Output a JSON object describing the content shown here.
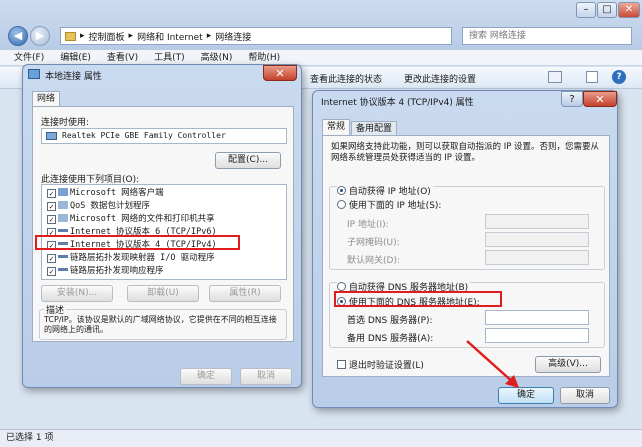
{
  "window": {
    "min": "–",
    "max": "□",
    "close": "✕"
  },
  "address": {
    "path_1": "控制面板",
    "path_2": "网络和 Internet",
    "path_3": "网络连接",
    "sep": "▸"
  },
  "search": {
    "placeholder": "搜索 网络连接"
  },
  "menu": [
    "文件(F)",
    "编辑(E)",
    "查看(V)",
    "工具(T)",
    "高级(N)",
    "帮助(H)"
  ],
  "cmdbar": {
    "view_status": "查看此连接的状态",
    "change_settings": "更改此连接的设置"
  },
  "status": {
    "selected": "已选择 1 项"
  },
  "local_dialog": {
    "title": "本地连接 属性",
    "tab_network": "网络",
    "connect_using_label": "连接时使用:",
    "adapter": "Realtek PCIe GBE Family Controller",
    "configure_button": "配置(C)...",
    "items_label": "此连接使用下列项目(O):",
    "items": [
      "Microsoft 网络客户端",
      "QoS 数据包计划程序",
      "Microsoft 网络的文件和打印机共享",
      "Internet 协议版本 6 (TCP/IPv6)",
      "Internet 协议版本 4 (TCP/IPv4)",
      "链路层拓扑发现映射器 I/O 驱动程序",
      "链路层拓扑发现响应程序"
    ],
    "install_button": "安装(N)...",
    "uninstall_button": "卸载(U)",
    "properties_button": "属性(R)",
    "description_legend": "描述",
    "description_text": "TCP/IP。该协议是默认的广域网络协议，它提供在不同的相互连接的网络上的通讯。",
    "ok_button": "确定",
    "cancel_button": "取消",
    "close": "✕"
  },
  "ipv4_dialog": {
    "title": "Internet 协议版本 4 (TCP/IPv4) 属性",
    "help": "?",
    "close": "✕",
    "tab_general": "常规",
    "tab_alternate": "备用配置",
    "intro": "如果网络支持此功能，则可以获取自动指派的 IP 设置。否则，您需要从网络系统管理员处获得适当的 IP 设置。",
    "auto_ip": "自动获得 IP 地址(O)",
    "manual_ip": "使用下面的 IP 地址(S):",
    "ip_address": "IP 地址(I):",
    "subnet_mask": "子网掩码(U):",
    "default_gateway": "默认网关(D):",
    "auto_dns": "自动获得 DNS 服务器地址(B)",
    "manual_dns": "使用下面的 DNS 服务器地址(E):",
    "preferred_dns": "首选 DNS 服务器(P):",
    "alternate_dns": "备用 DNS 服务器(A):",
    "validate_on_exit": "退出时验证设置(L)",
    "advanced_button": "高级(V)...",
    "ok_button": "确定",
    "cancel_button": "取消"
  }
}
